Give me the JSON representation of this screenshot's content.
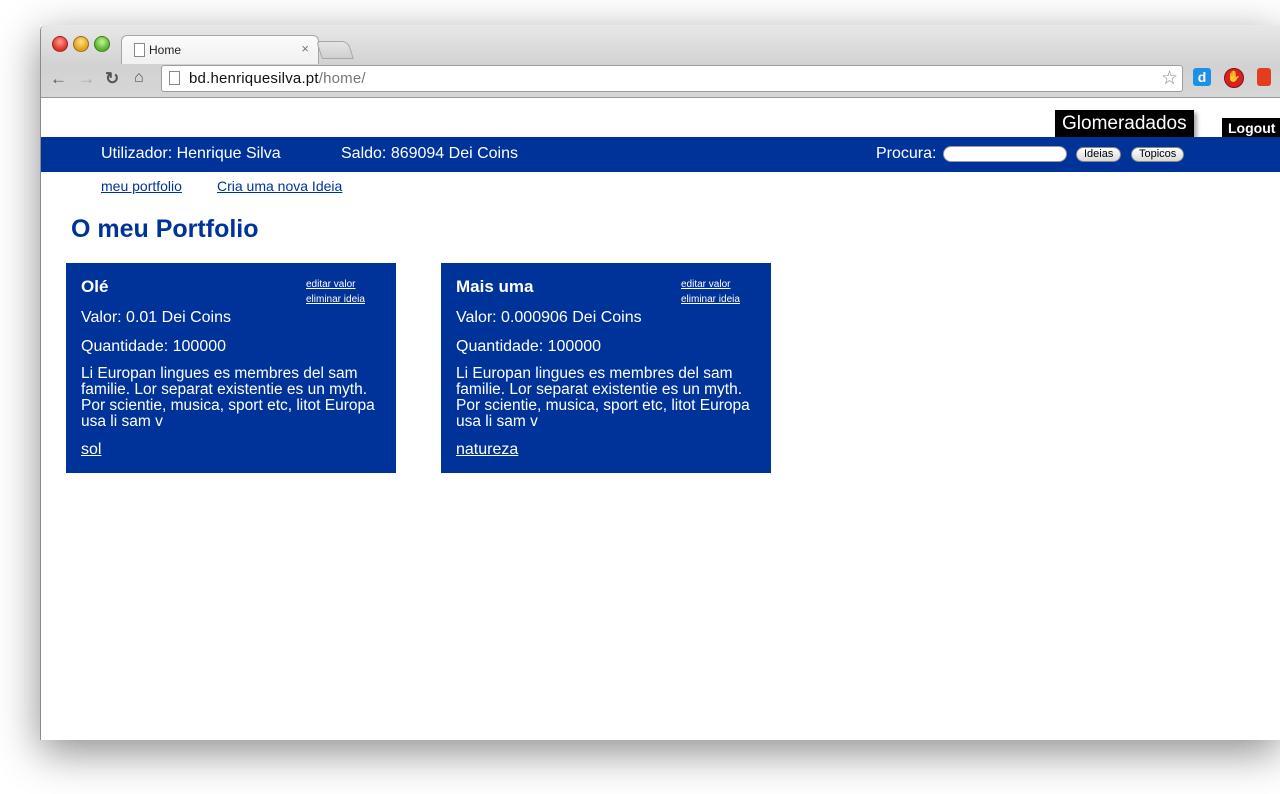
{
  "browser": {
    "tab_title": "Home",
    "tab_close": "×",
    "url_host": "bd.henriquesilva.pt",
    "url_path": "/home/",
    "icons": [
      "back-icon",
      "forward-icon",
      "reload-icon",
      "home-icon",
      "page-icon",
      "star-icon",
      "extension-d-icon",
      "extension-stop-icon",
      "extension-bookmark-icon"
    ]
  },
  "header": {
    "brand": "Glomeradados",
    "logout": "Logout"
  },
  "bar": {
    "user": "Utilizador: Henrique Silva",
    "saldo": "Saldo: 869094 Dei Coins",
    "search_label": "Procura:",
    "search_value": "",
    "btn_ideias": "Ideias",
    "btn_topicos": "Topicos"
  },
  "subnav": {
    "portfolio": "meu portfolio",
    "nova_ideia": "Cria uma nova Ideia"
  },
  "main": {
    "title": "O meu Portfolio",
    "cards": [
      {
        "name": "Olé",
        "edit": "editar valor",
        "delete": "eliminar ideia",
        "valor": "Valor: 0.01 Dei Coins",
        "quantidade": "Quantidade: 100000",
        "description": "Li Europan lingues es membres del sam familie. Lor separat existentie es un myth. Por scientie, musica, sport etc, litot Europa usa li sam v",
        "topic": "sol"
      },
      {
        "name": "Mais uma",
        "edit": "editar valor",
        "delete": "eliminar ideia",
        "valor": "Valor: 0.000906 Dei Coins",
        "quantidade": "Quantidade: 100000",
        "description": "Li Europan lingues es membres del sam familie. Lor separat existentie es un myth. Por scientie, musica, sport etc, litot Europa usa li sam v",
        "topic": "natureza"
      }
    ]
  },
  "colors": {
    "primary": "#003399",
    "brand_bg": "#000000",
    "text_on_primary": "#ffffff"
  }
}
